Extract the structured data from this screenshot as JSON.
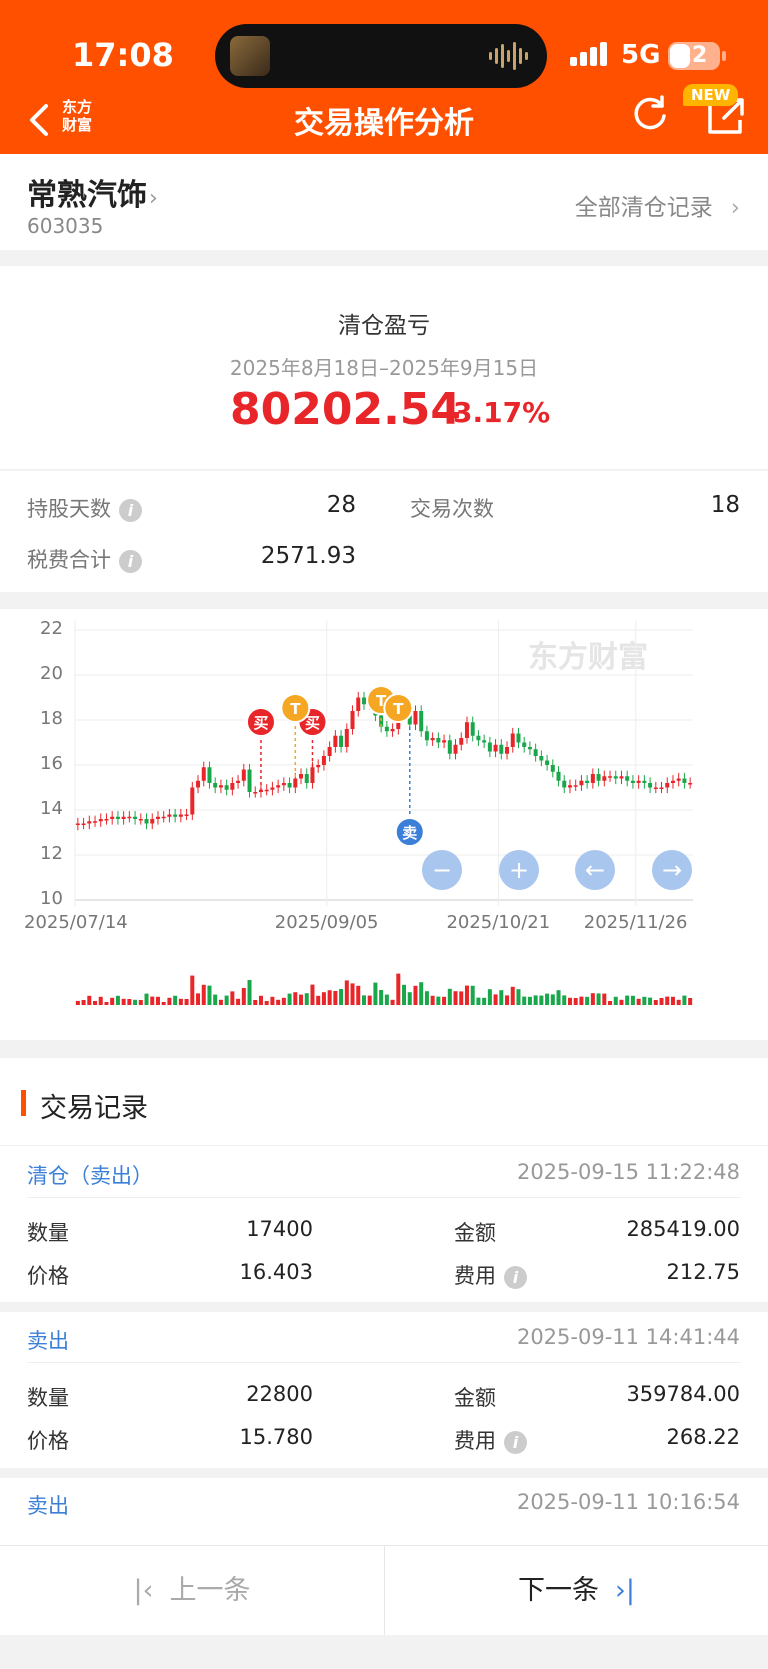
{
  "status_bar": {
    "time": "17:08",
    "network": "5G",
    "battery": "22"
  },
  "nav": {
    "title": "交易操作分析",
    "logo_line1": "东方",
    "logo_line2": "财富",
    "new_badge": "NEW"
  },
  "stock": {
    "name": "常熟汽饰",
    "code": "603035",
    "all_records": "全部清仓记录"
  },
  "pnl": {
    "title": "清仓盈亏",
    "range": "2025年8月18日–2025年9月15日",
    "amount": "80202.54",
    "percent": "3.17%"
  },
  "stats": {
    "hold_days_label": "持股天数",
    "hold_days": "28",
    "trade_count_label": "交易次数",
    "trade_count": "18",
    "fee_total_label": "税费合计",
    "fee_total": "2571.93"
  },
  "chart_data": {
    "type": "candlestick",
    "watermark": "东方财富",
    "y_ticks": [
      "22",
      "20",
      "18",
      "16",
      "14",
      "12",
      "10"
    ],
    "ylim": [
      10,
      22
    ],
    "x_ticks": [
      "2025/07/14",
      "2025/09/05",
      "2025/10/21",
      "2025/11/26"
    ],
    "close_approx": [
      13.4,
      13.4,
      13.5,
      13.5,
      13.6,
      13.6,
      13.7,
      13.6,
      13.7,
      13.7,
      13.6,
      13.6,
      13.4,
      13.6,
      13.7,
      13.7,
      13.8,
      13.7,
      13.8,
      13.8,
      15.0,
      15.3,
      15.9,
      15.2,
      15.0,
      15.1,
      14.9,
      15.2,
      15.3,
      15.8,
      14.8,
      14.8,
      14.9,
      14.9,
      15.0,
      15.1,
      15.2,
      15.0,
      15.4,
      15.6,
      15.2,
      15.9,
      16.0,
      16.4,
      16.8,
      17.3,
      16.8,
      17.6,
      18.4,
      19.0,
      18.7,
      18.9,
      18.2,
      17.7,
      17.5,
      17.6,
      18.8,
      18.2,
      17.8,
      18.4,
      17.5,
      17.1,
      17.2,
      17.0,
      17.1,
      16.5,
      16.9,
      17.2,
      17.9,
      17.3,
      17.1,
      17.0,
      16.6,
      16.9,
      16.5,
      16.8,
      17.4,
      17.0,
      16.8,
      16.7,
      16.4,
      16.2,
      16.0,
      15.7,
      15.3,
      15.0,
      15.1,
      15.1,
      15.3,
      15.2,
      15.6,
      15.3,
      15.5,
      15.5,
      15.4,
      15.5,
      15.3,
      15.2,
      15.3,
      15.2,
      15.0,
      15.0,
      15.0,
      15.2,
      15.3,
      15.4,
      15.2,
      15.2
    ],
    "markers": [
      {
        "label": "买",
        "kind": "buy",
        "index": 32
      },
      {
        "label": "买",
        "kind": "buy",
        "index": 41
      },
      {
        "label": "T",
        "kind": "t",
        "index": 38
      },
      {
        "label": "T",
        "kind": "t",
        "index": 53
      },
      {
        "label": "T",
        "kind": "t",
        "index": 56
      },
      {
        "label": "卖",
        "kind": "sell",
        "index": 58
      }
    ],
    "controls": [
      "zoom-out",
      "zoom-in",
      "left",
      "right"
    ]
  },
  "records": {
    "title": "交易记录",
    "items": [
      {
        "type": "清仓（卖出）",
        "time": "2025-09-15 11:22:48",
        "qty_label": "数量",
        "qty": "17400",
        "amount_label": "金额",
        "amount": "285419.00",
        "price_label": "价格",
        "price": "16.403",
        "fee_label": "费用",
        "fee": "212.75"
      },
      {
        "type": "卖出",
        "time": "2025-09-11 14:41:44",
        "qty_label": "数量",
        "qty": "22800",
        "amount_label": "金额",
        "amount": "359784.00",
        "price_label": "价格",
        "price": "15.780",
        "fee_label": "费用",
        "fee": "268.22"
      },
      {
        "type": "卖出",
        "time": "2025-09-11 10:16:54"
      }
    ]
  },
  "bottom": {
    "prev": "上一条",
    "next": "下一条"
  },
  "colors": {
    "brand": "#ff5000",
    "up": "#e8262a",
    "down": "#1aa64a",
    "link": "#3b7fd8"
  }
}
